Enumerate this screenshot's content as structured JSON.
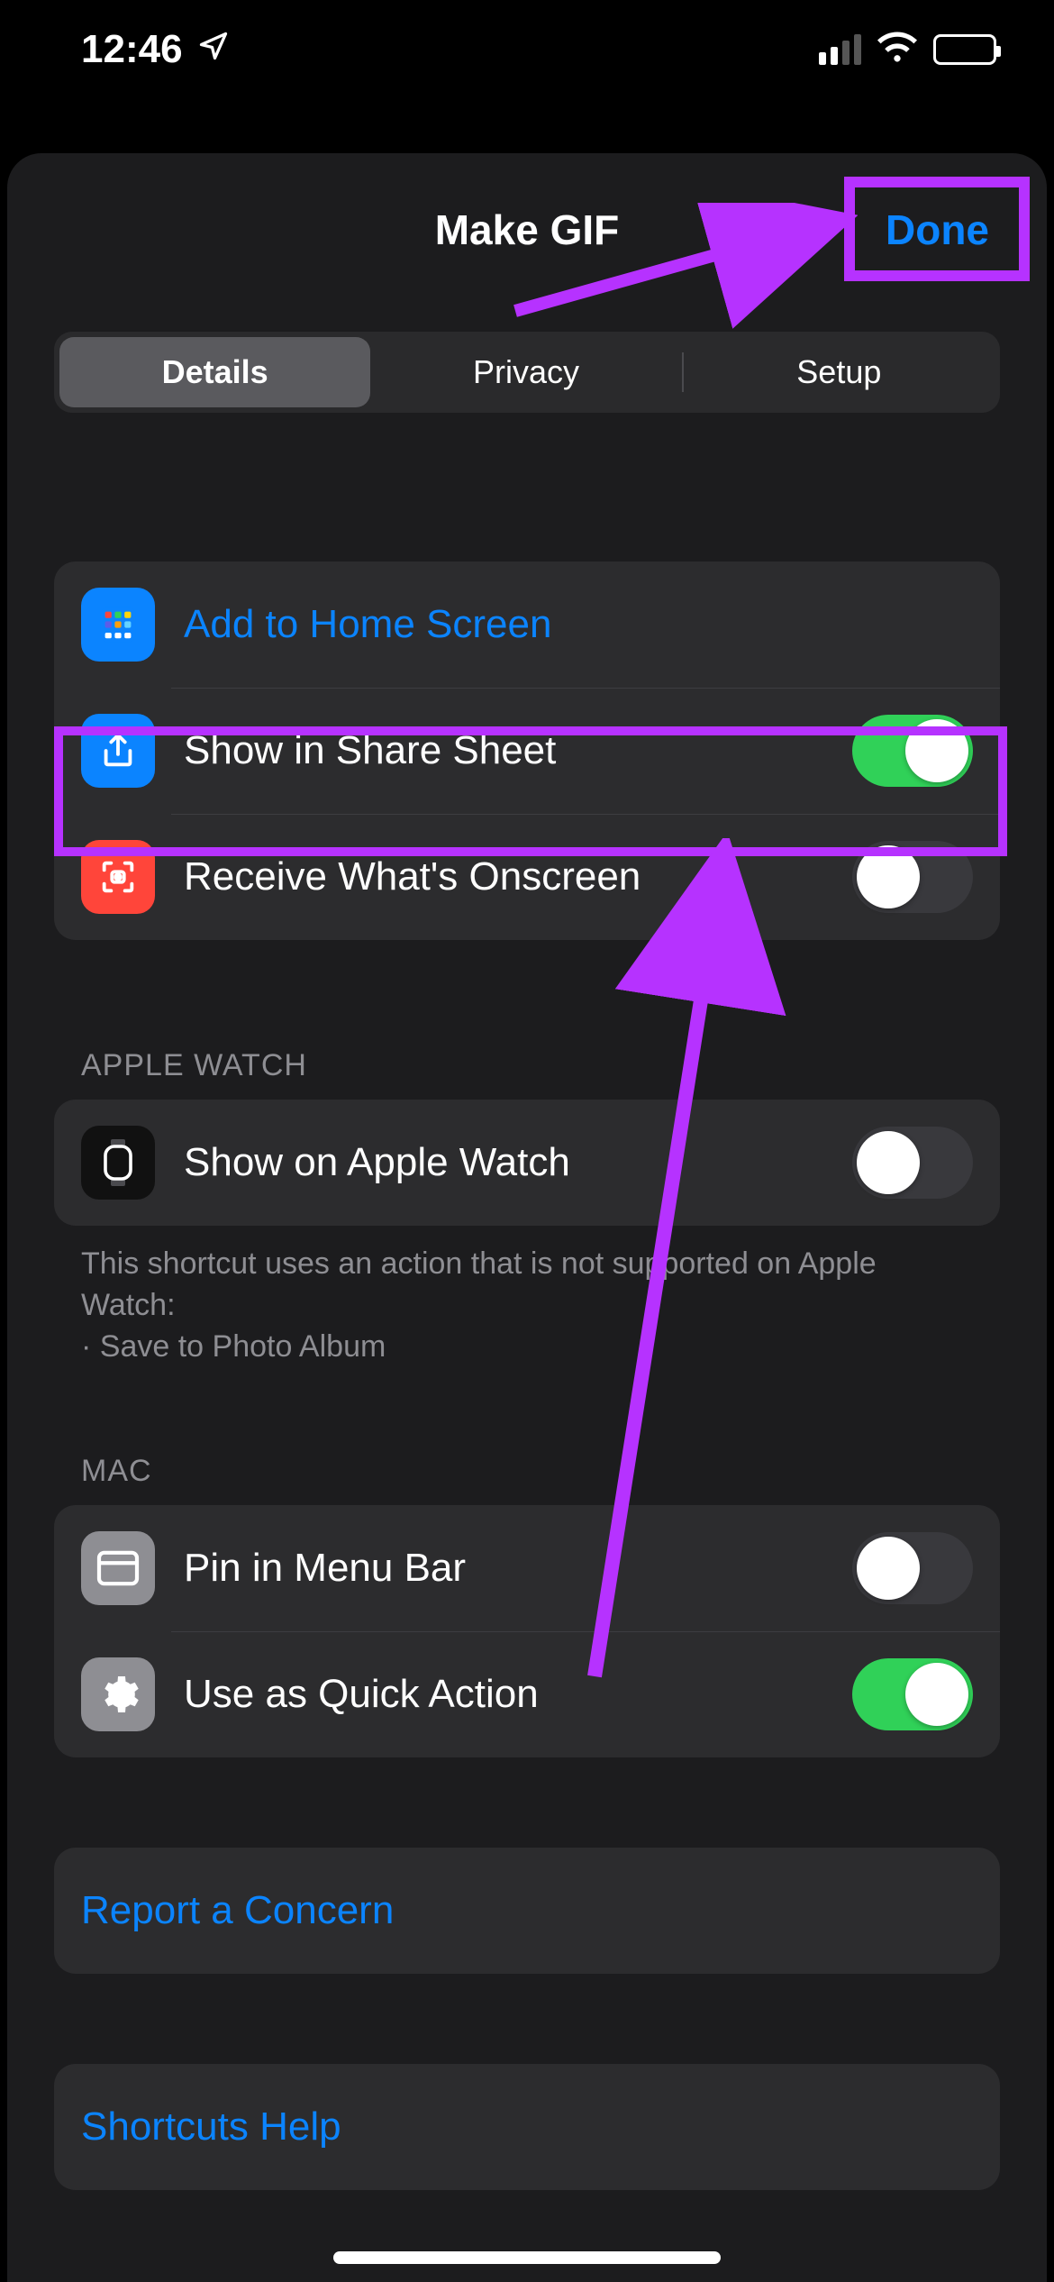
{
  "status": {
    "time": "12:46"
  },
  "nav": {
    "title": "Make GIF",
    "done": "Done"
  },
  "tabs": {
    "details": "Details",
    "privacy": "Privacy",
    "setup": "Setup"
  },
  "group1": {
    "add_home": "Add to Home Screen",
    "share_sheet": "Show in Share Sheet",
    "receive_onscreen": "Receive What's Onscreen",
    "share_on": true,
    "receive_on": false
  },
  "group2": {
    "header": "APPLE WATCH",
    "show_watch": "Show on Apple Watch",
    "show_watch_on": false,
    "footer": "This shortcut uses an action that is not supported on Apple Watch:\n· Save to Photo Album"
  },
  "group3": {
    "header": "MAC",
    "pin_menu": "Pin in Menu Bar",
    "pin_on": false,
    "quick_action": "Use as Quick Action",
    "quick_on": true
  },
  "report": "Report a Concern",
  "help": "Shortcuts Help",
  "colors": {
    "annot": "#b632ff",
    "link": "#0b84ff"
  }
}
